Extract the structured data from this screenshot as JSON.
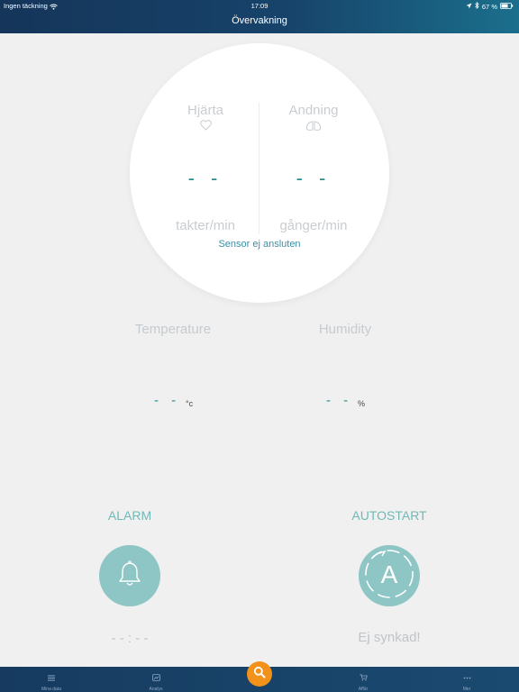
{
  "status_bar": {
    "carrier": "Ingen täckning",
    "time": "17:09",
    "battery": "67 %"
  },
  "header": {
    "title": "Övervakning"
  },
  "vitals": {
    "heart": {
      "label": "Hjärta",
      "value": "- -",
      "unit": "takter/min",
      "icon": "heart-icon"
    },
    "breathing": {
      "label": "Andning",
      "value": "- -",
      "unit": "gånger/min",
      "icon": "lungs-icon"
    },
    "sensor_status": "Sensor ej ansluten"
  },
  "environment": {
    "temperature": {
      "label": "Temperature",
      "value": "- -",
      "unit": "°c"
    },
    "humidity": {
      "label": "Humidity",
      "value": "- -",
      "unit": "%"
    }
  },
  "alarm": {
    "title": "ALARM",
    "time": "- - : - -",
    "icon": "bell-icon"
  },
  "autostart": {
    "title": "AUTOSTART",
    "status": "Ej synkad!",
    "icon_letter": "A"
  },
  "tabs": [
    {
      "label": "Mina data",
      "icon": "list-icon"
    },
    {
      "label": "Analys",
      "icon": "chart-icon"
    },
    {
      "label": "Affär",
      "icon": "cart-icon"
    },
    {
      "label": "Mer",
      "icon": "more-icon"
    }
  ],
  "colors": {
    "accent_teal": "#2a8c8c",
    "button_teal": "#8ec5c5",
    "search_orange": "#f2921b",
    "header_navy": "#15355a"
  }
}
